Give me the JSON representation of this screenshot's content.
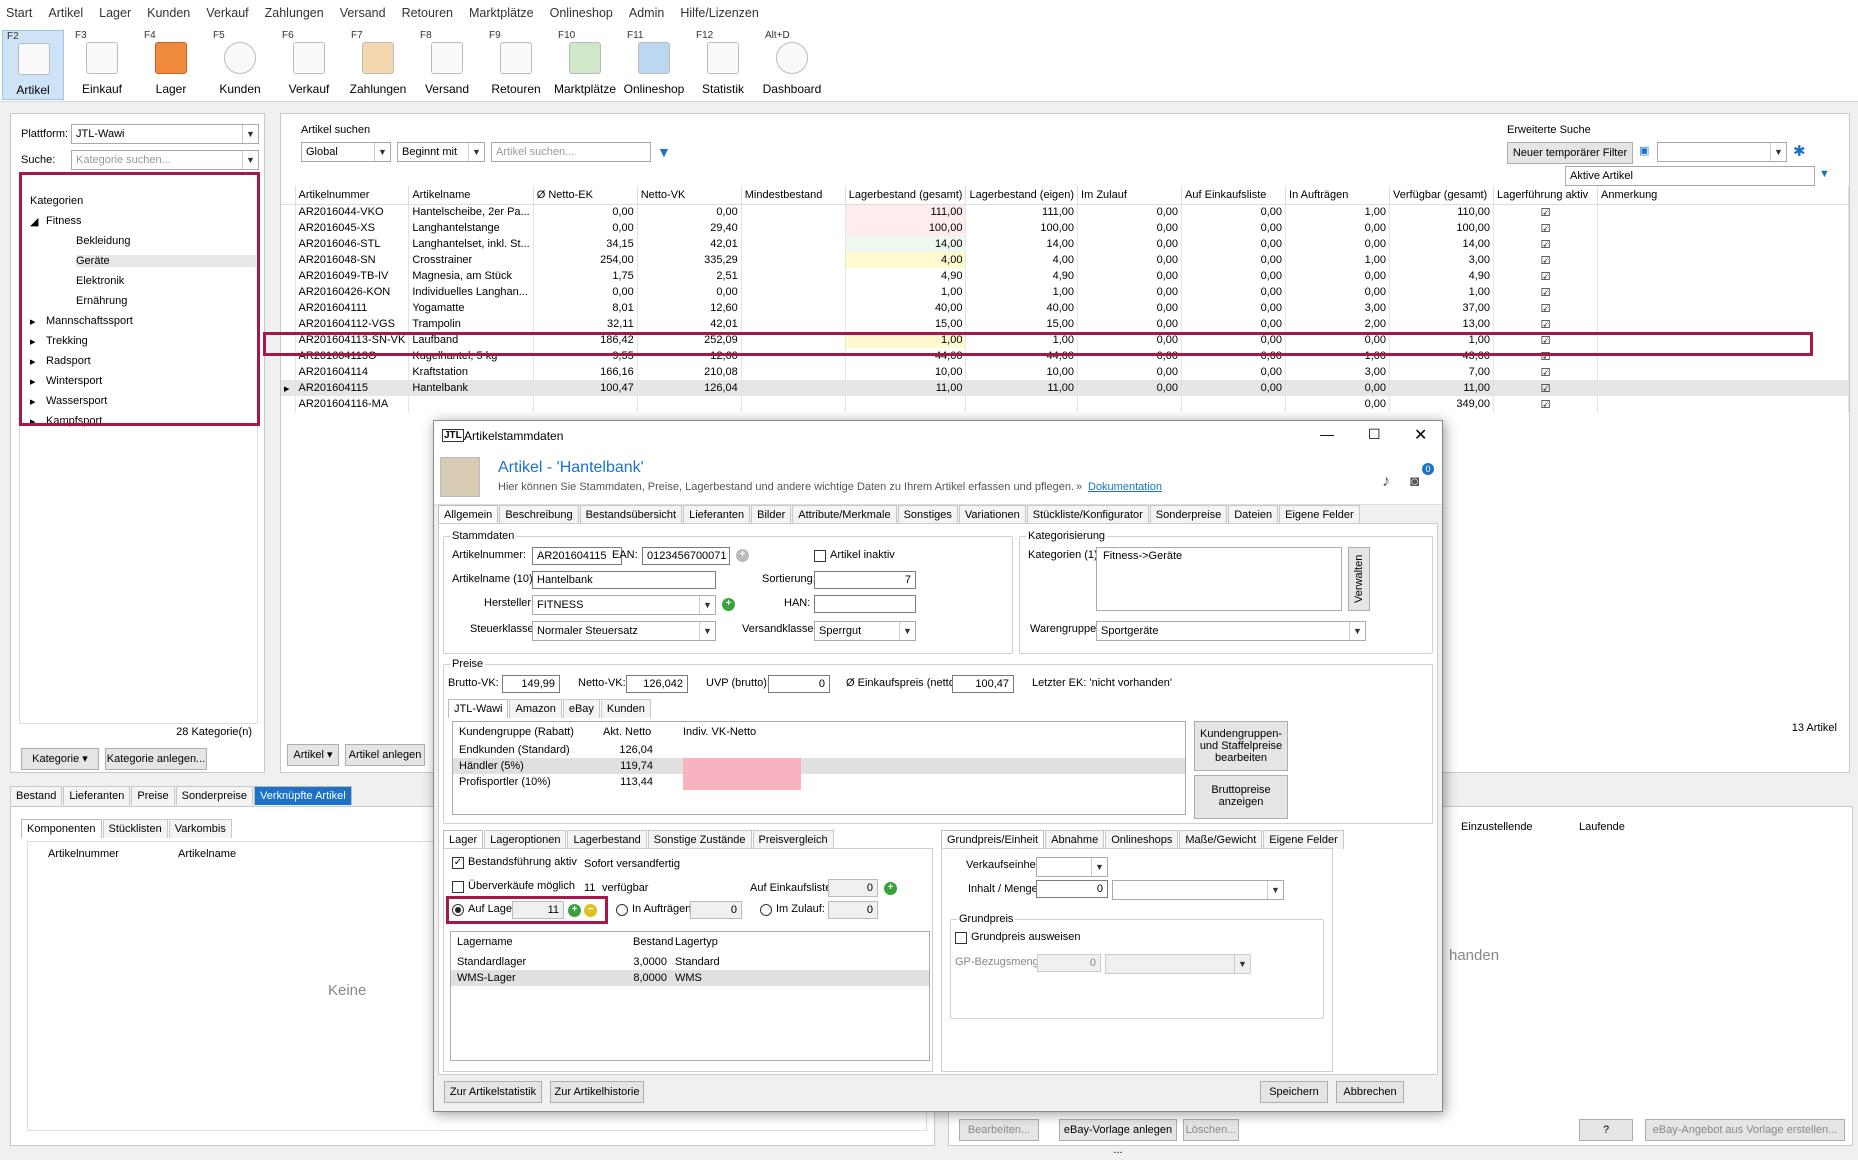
{
  "menu": [
    "Start",
    "Artikel",
    "Lager",
    "Kunden",
    "Verkauf",
    "Zahlungen",
    "Versand",
    "Retouren",
    "Marktplätze",
    "Onlineshop",
    "Admin",
    "Hilfe/Lizenzen"
  ],
  "ribbon": [
    {
      "key": "F2",
      "label": "Artikel"
    },
    {
      "key": "F3",
      "label": "Einkauf"
    },
    {
      "key": "F4",
      "label": "Lager"
    },
    {
      "key": "F5",
      "label": "Kunden"
    },
    {
      "key": "F6",
      "label": "Verkauf"
    },
    {
      "key": "F7",
      "label": "Zahlungen"
    },
    {
      "key": "F8",
      "label": "Versand"
    },
    {
      "key": "F9",
      "label": "Retouren"
    },
    {
      "key": "F10",
      "label": "Marktplätze"
    },
    {
      "key": "F11",
      "label": "Onlineshop"
    },
    {
      "key": "F12",
      "label": "Statistik"
    },
    {
      "key": "Alt+D",
      "label": "Dashboard"
    }
  ],
  "left": {
    "plattform_label": "Plattform:",
    "plattform_value": "JTL-Wawi",
    "suche_label": "Suche:",
    "suche_placeholder": "Kategorie suchen...",
    "tree": {
      "root": "Kategorien",
      "fitness": "Fitness",
      "fitness_children": [
        "Bekleidung",
        "Geräte",
        "Elektronik",
        "Ernährung"
      ],
      "others": [
        "Mannschaftssport",
        "Trekking",
        "Radsport",
        "Wintersport",
        "Wassersport",
        "Kampfsport"
      ]
    },
    "count": "28 Kategorie(n)",
    "btn_kategorie": "Kategorie",
    "btn_anlegen": "Kategorie anlegen..."
  },
  "search": {
    "group": "Artikel suchen",
    "scope": "Global",
    "mode": "Beginnt mit",
    "placeholder": "Artikel suchen...",
    "erweitert": "Erweiterte Suche",
    "temp_filter": "Neuer temporärer Filter",
    "aktive": "Aktive Artikel"
  },
  "grid": {
    "columns": [
      "Artikelnummer",
      "Artikelname",
      "Ø Netto-EK",
      "Netto-VK",
      "Mindestbestand",
      "Lagerbestand (gesamt)",
      "Lagerbestand (eigen)",
      "Im Zulauf",
      "Auf Einkaufsliste",
      "In Aufträgen",
      "Verfügbar (gesamt)",
      "Lagerführung aktiv",
      "Anmerkung"
    ],
    "rows": [
      [
        "AR2016044-VKO",
        "Hantelscheibe, 2er Pa...",
        "0,00",
        "0,00",
        "",
        "111,00",
        "111,00",
        "0,00",
        "0,00",
        "1,00",
        "110,00"
      ],
      [
        "AR2016045-XS",
        "Langhantelstange",
        "0,00",
        "29,40",
        "",
        "100,00",
        "100,00",
        "0,00",
        "0,00",
        "0,00",
        "100,00"
      ],
      [
        "AR2016046-STL",
        "Langhantelset, inkl. St...",
        "34,15",
        "42,01",
        "",
        "14,00",
        "14,00",
        "0,00",
        "0,00",
        "0,00",
        "14,00"
      ],
      [
        "AR2016048-SN",
        "Crosstrainer",
        "254,00",
        "335,29",
        "",
        "4,00",
        "4,00",
        "0,00",
        "0,00",
        "1,00",
        "3,00"
      ],
      [
        "AR2016049-TB-IV",
        "Magnesia, am Stück",
        "1,75",
        "2,51",
        "",
        "4,90",
        "4,90",
        "0,00",
        "0,00",
        "0,00",
        "4,90"
      ],
      [
        "AR20160426-KON",
        "Individuelles Langhan...",
        "0,00",
        "0,00",
        "",
        "1,00",
        "1,00",
        "0,00",
        "0,00",
        "0,00",
        "1,00"
      ],
      [
        "AR201604111",
        "Yogamatte",
        "8,01",
        "12,60",
        "",
        "40,00",
        "40,00",
        "0,00",
        "0,00",
        "3,00",
        "37,00"
      ],
      [
        "AR201604112-VGS",
        "Trampolin",
        "32,11",
        "42,01",
        "",
        "15,00",
        "15,00",
        "0,00",
        "0,00",
        "2,00",
        "13,00"
      ],
      [
        "AR201604113-SN-VK",
        "Laufband",
        "186,42",
        "252,09",
        "",
        "1,00",
        "1,00",
        "0,00",
        "0,00",
        "0,00",
        "1,00"
      ],
      [
        "AR201604113O",
        "Kugelhantel, 5 kg",
        "9,55",
        "12,60",
        "",
        "44,00",
        "44,00",
        "0,00",
        "0,00",
        "1,00",
        "43,00"
      ],
      [
        "AR201604114",
        "Kraftstation",
        "166,16",
        "210,08",
        "",
        "10,00",
        "10,00",
        "0,00",
        "0,00",
        "3,00",
        "7,00"
      ],
      [
        "AR201604115",
        "Hantelbank",
        "100,47",
        "126,04",
        "",
        "11,00",
        "11,00",
        "0,00",
        "0,00",
        "0,00",
        "11,00"
      ],
      [
        "AR201604116-MA",
        "",
        "",
        "",
        "",
        "",
        "",
        "",
        "",
        "0,00",
        "349,00"
      ]
    ],
    "count": "13 Artikel",
    "btn_artikel": "Artikel",
    "btn_anlegen": "Artikel anlegen"
  },
  "bottom": {
    "tabs": [
      "Bestand",
      "Lieferanten",
      "Preise",
      "Sonderpreise",
      "Verknüpfte Artikel"
    ],
    "subtabs": [
      "Komponenten",
      "Stücklisten",
      "Varkombis"
    ],
    "col1": "Artikelnummer",
    "col2": "Artikelname",
    "empty": "Keine",
    "empty_right": "handen",
    "right_col1": "Einzustellende",
    "right_col2": "Laufende",
    "btn_bearbeiten": "Bearbeiten...",
    "btn_ebay": "eBay-Vorlage anlegen ...",
    "btn_loeschen": "Löschen...",
    "btn_q": "?",
    "btn_ebay2": "eBay-Angebot aus Vorlage erstellen..."
  },
  "dialog": {
    "window_title": "Artikelstammdaten",
    "title": "Artikel - 'Hantelbank'",
    "subtitle": "Hier können Sie Stammdaten, Preise, Lagerbestand und andere wichtige Daten zu Ihrem Artikel erfassen und pflegen.",
    "doc_link": "Dokumentation",
    "badge": "0",
    "tabs": [
      "Allgemein",
      "Beschreibung",
      "Bestandsübersicht",
      "Lieferanten",
      "Bilder",
      "Attribute/Merkmale",
      "Sonstiges",
      "Variationen",
      "Stückliste/Konfigurator",
      "Sonderpreise",
      "Dateien",
      "Eigene Felder"
    ],
    "stammdaten": {
      "group": "Stammdaten",
      "artnr_label": "Artikelnummer:",
      "artnr": "AR201604115",
      "ean_label": "EAN:",
      "ean": "0123456700071",
      "inaktiv": "Artikel inaktiv",
      "name_label": "Artikelname (10):",
      "name": "Hantelbank",
      "sort_label": "Sortierung:",
      "sort": "7",
      "hersteller_label": "Hersteller:",
      "hersteller": "FITNESS",
      "han_label": "HAN:",
      "han": "",
      "steuer_label": "Steuerklasse:",
      "steuer": "Normaler Steuersatz",
      "versand_label": "Versandklasse:",
      "versand": "Sperrgut"
    },
    "kategorisierung": {
      "group": "Kategorisierung",
      "kat_label": "Kategorien (1):",
      "kat_value": "Fitness->Geräte",
      "verwalten": "Verwalten",
      "waren_label": "Warengruppe:",
      "waren": "Sportgeräte"
    },
    "preise": {
      "group": "Preise",
      "brutto_label": "Brutto-VK:",
      "brutto": "149,99",
      "netto_label": "Netto-VK:",
      "netto": "126,042",
      "uvp_label": "UVP (brutto):",
      "uvp": "0",
      "ek_label": "Ø Einkaufspreis (netto):",
      "ek": "100,47",
      "letzter": "Letzter EK: 'nicht vorhanden'",
      "tabs": [
        "JTL-Wawi",
        "Amazon",
        "eBay",
        "Kunden"
      ],
      "cols": [
        "Kundengruppe (Rabatt)",
        "Akt. Netto",
        "Indiv. VK-Netto"
      ],
      "rows": [
        [
          "Endkunden (Standard)",
          "126,04",
          ""
        ],
        [
          "Händler (5%)",
          "119,74",
          ""
        ],
        [
          "Profisportler (10%)",
          "113,44",
          ""
        ]
      ],
      "btn_staffel": "Kundengruppen- und Staffelpreise bearbeiten",
      "btn_brutto": "Bruttopreise anzeigen"
    },
    "lager": {
      "tabs": [
        "Lager",
        "Lageroptionen",
        "Lagerbestand",
        "Sonstige Zustände",
        "Preisvergleich"
      ],
      "bestand_aktiv": "Bestandsführung aktiv",
      "sofort": "Sofort versandfertig",
      "ueberverkauf": "Überverkäufe möglich",
      "verfuegbar_n": "11",
      "verfuegbar": "verfügbar",
      "einkauf_label": "Auf Einkaufsliste:",
      "einkauf": "0",
      "auf_lager_label": "Auf Lager:",
      "auf_lager": "11",
      "auftraege_label": "In Aufträgen:",
      "auftraege": "0",
      "zulauf_label": "Im Zulauf:",
      "zulauf": "0",
      "cols": [
        "Lagername",
        "Bestand",
        "Lagertyp"
      ],
      "rows": [
        [
          "Standardlager",
          "3,0000",
          "Standard"
        ],
        [
          "WMS-Lager",
          "8,0000",
          "WMS"
        ]
      ]
    },
    "grundpreis": {
      "tabs": [
        "Grundpreis/Einheit",
        "Abnahme",
        "Onlineshops",
        "Maße/Gewicht",
        "Eigene Felder"
      ],
      "vk_einheit": "Verkaufseinheit:",
      "inhalt": "Inhalt / Menge:",
      "inhalt_val": "0",
      "group": "Grundpreis",
      "ausweisen": "Grundpreis ausweisen",
      "gp_menge": "GP-Bezugsmenge:",
      "gp_val": "0"
    },
    "footer": {
      "statistik": "Zur Artikelstatistik",
      "historie": "Zur Artikelhistorie",
      "speichern": "Speichern",
      "abbrechen": "Abbrechen"
    }
  }
}
